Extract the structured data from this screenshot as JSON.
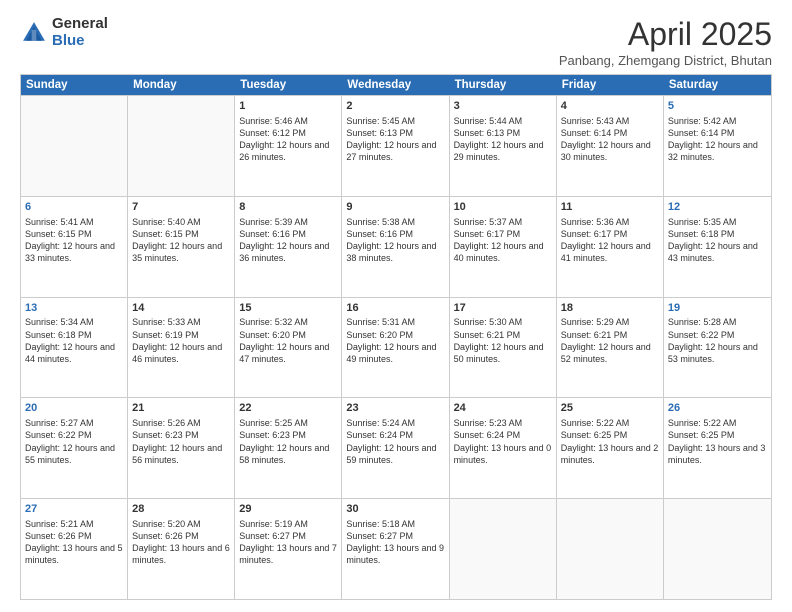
{
  "logo": {
    "general": "General",
    "blue": "Blue"
  },
  "title": "April 2025",
  "location": "Panbang, Zhemgang District, Bhutan",
  "days": [
    "Sunday",
    "Monday",
    "Tuesday",
    "Wednesday",
    "Thursday",
    "Friday",
    "Saturday"
  ],
  "weeks": [
    [
      {
        "day": "",
        "info": ""
      },
      {
        "day": "",
        "info": ""
      },
      {
        "day": "1",
        "info": "Sunrise: 5:46 AM\nSunset: 6:12 PM\nDaylight: 12 hours and 26 minutes."
      },
      {
        "day": "2",
        "info": "Sunrise: 5:45 AM\nSunset: 6:13 PM\nDaylight: 12 hours and 27 minutes."
      },
      {
        "day": "3",
        "info": "Sunrise: 5:44 AM\nSunset: 6:13 PM\nDaylight: 12 hours and 29 minutes."
      },
      {
        "day": "4",
        "info": "Sunrise: 5:43 AM\nSunset: 6:14 PM\nDaylight: 12 hours and 30 minutes."
      },
      {
        "day": "5",
        "info": "Sunrise: 5:42 AM\nSunset: 6:14 PM\nDaylight: 12 hours and 32 minutes."
      }
    ],
    [
      {
        "day": "6",
        "info": "Sunrise: 5:41 AM\nSunset: 6:15 PM\nDaylight: 12 hours and 33 minutes."
      },
      {
        "day": "7",
        "info": "Sunrise: 5:40 AM\nSunset: 6:15 PM\nDaylight: 12 hours and 35 minutes."
      },
      {
        "day": "8",
        "info": "Sunrise: 5:39 AM\nSunset: 6:16 PM\nDaylight: 12 hours and 36 minutes."
      },
      {
        "day": "9",
        "info": "Sunrise: 5:38 AM\nSunset: 6:16 PM\nDaylight: 12 hours and 38 minutes."
      },
      {
        "day": "10",
        "info": "Sunrise: 5:37 AM\nSunset: 6:17 PM\nDaylight: 12 hours and 40 minutes."
      },
      {
        "day": "11",
        "info": "Sunrise: 5:36 AM\nSunset: 6:17 PM\nDaylight: 12 hours and 41 minutes."
      },
      {
        "day": "12",
        "info": "Sunrise: 5:35 AM\nSunset: 6:18 PM\nDaylight: 12 hours and 43 minutes."
      }
    ],
    [
      {
        "day": "13",
        "info": "Sunrise: 5:34 AM\nSunset: 6:18 PM\nDaylight: 12 hours and 44 minutes."
      },
      {
        "day": "14",
        "info": "Sunrise: 5:33 AM\nSunset: 6:19 PM\nDaylight: 12 hours and 46 minutes."
      },
      {
        "day": "15",
        "info": "Sunrise: 5:32 AM\nSunset: 6:20 PM\nDaylight: 12 hours and 47 minutes."
      },
      {
        "day": "16",
        "info": "Sunrise: 5:31 AM\nSunset: 6:20 PM\nDaylight: 12 hours and 49 minutes."
      },
      {
        "day": "17",
        "info": "Sunrise: 5:30 AM\nSunset: 6:21 PM\nDaylight: 12 hours and 50 minutes."
      },
      {
        "day": "18",
        "info": "Sunrise: 5:29 AM\nSunset: 6:21 PM\nDaylight: 12 hours and 52 minutes."
      },
      {
        "day": "19",
        "info": "Sunrise: 5:28 AM\nSunset: 6:22 PM\nDaylight: 12 hours and 53 minutes."
      }
    ],
    [
      {
        "day": "20",
        "info": "Sunrise: 5:27 AM\nSunset: 6:22 PM\nDaylight: 12 hours and 55 minutes."
      },
      {
        "day": "21",
        "info": "Sunrise: 5:26 AM\nSunset: 6:23 PM\nDaylight: 12 hours and 56 minutes."
      },
      {
        "day": "22",
        "info": "Sunrise: 5:25 AM\nSunset: 6:23 PM\nDaylight: 12 hours and 58 minutes."
      },
      {
        "day": "23",
        "info": "Sunrise: 5:24 AM\nSunset: 6:24 PM\nDaylight: 12 hours and 59 minutes."
      },
      {
        "day": "24",
        "info": "Sunrise: 5:23 AM\nSunset: 6:24 PM\nDaylight: 13 hours and 0 minutes."
      },
      {
        "day": "25",
        "info": "Sunrise: 5:22 AM\nSunset: 6:25 PM\nDaylight: 13 hours and 2 minutes."
      },
      {
        "day": "26",
        "info": "Sunrise: 5:22 AM\nSunset: 6:25 PM\nDaylight: 13 hours and 3 minutes."
      }
    ],
    [
      {
        "day": "27",
        "info": "Sunrise: 5:21 AM\nSunset: 6:26 PM\nDaylight: 13 hours and 5 minutes."
      },
      {
        "day": "28",
        "info": "Sunrise: 5:20 AM\nSunset: 6:26 PM\nDaylight: 13 hours and 6 minutes."
      },
      {
        "day": "29",
        "info": "Sunrise: 5:19 AM\nSunset: 6:27 PM\nDaylight: 13 hours and 7 minutes."
      },
      {
        "day": "30",
        "info": "Sunrise: 5:18 AM\nSunset: 6:27 PM\nDaylight: 13 hours and 9 minutes."
      },
      {
        "day": "",
        "info": ""
      },
      {
        "day": "",
        "info": ""
      },
      {
        "day": "",
        "info": ""
      }
    ]
  ]
}
